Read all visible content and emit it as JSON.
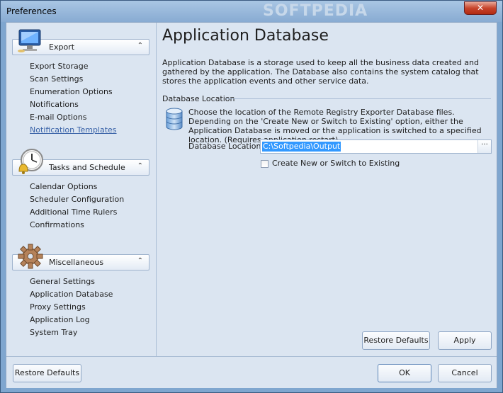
{
  "window": {
    "title": "Preferences",
    "watermark": "SOFTPEDIA",
    "close_glyph": "✕"
  },
  "sidebar": {
    "groups": [
      {
        "label": "Export",
        "icon": "monitor-icon",
        "items": [
          "Export Storage",
          "Scan Settings",
          "Enumeration Options",
          "Notifications",
          "E-mail Options",
          "Notification Templates"
        ]
      },
      {
        "label": "Tasks and Schedule",
        "icon": "clock-bell-icon",
        "items": [
          "Calendar Options",
          "Scheduler Configuration",
          "Additional Time Rulers",
          "Confirmations"
        ]
      },
      {
        "label": "Miscellaneous",
        "icon": "gear-icon",
        "items": [
          "General Settings",
          "Application Database",
          "Proxy Settings",
          "Application Log",
          "System Tray"
        ]
      }
    ],
    "chevron": "⌃"
  },
  "main": {
    "title": "Application Database",
    "description": "Application Database is a storage used to keep all the business data created and gathered by the application. The Database also contains the system catalog that stores the application events and other service data.",
    "section_label": "Database Location",
    "location_description": "Choose the location of the Remote Registry Exporter Database files. Depending on the 'Create New or Switch to Existing' option, either the Application Database is moved or the application is switched to a specified location. (Requires application restart)",
    "field_label": "Database Location:",
    "field_value": "C:\\Softpedia\\Output",
    "browse_glyph": "···",
    "checkbox_label": "Create New or Switch to Existing",
    "checkbox_checked": false,
    "restore_defaults": "Restore Defaults",
    "apply": "Apply"
  },
  "footer": {
    "restore_defaults": "Restore Defaults",
    "ok": "OK",
    "cancel": "Cancel"
  },
  "colors": {
    "accent_selection": "#3399ff",
    "link": "#3a63a8",
    "close_red": "#c7442c"
  }
}
